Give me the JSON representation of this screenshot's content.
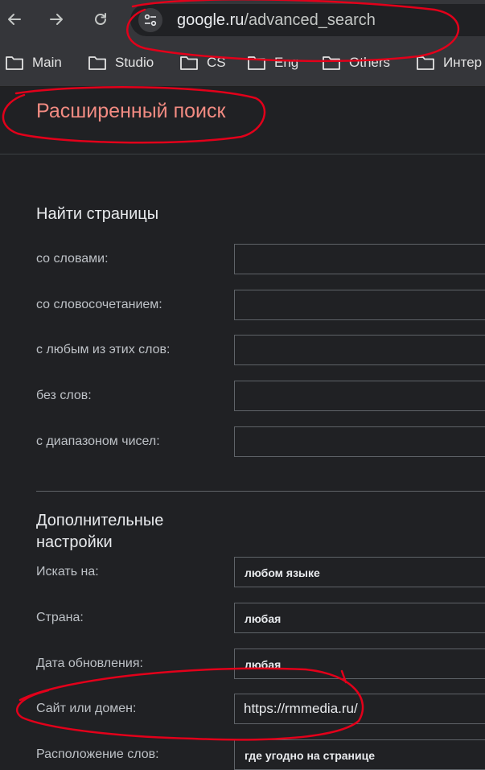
{
  "browser": {
    "url_host": "google.ru",
    "url_path": "/advanced_search",
    "bookmarks": [
      {
        "label": "Main"
      },
      {
        "label": "Studio"
      },
      {
        "label": "CS"
      },
      {
        "label": "Eng"
      },
      {
        "label": "Others"
      },
      {
        "label": "Интер"
      }
    ]
  },
  "page": {
    "title": "Расширенный поиск",
    "find_pages": {
      "heading": "Найти страницы",
      "rows": [
        {
          "label": "со словами:",
          "value": ""
        },
        {
          "label": "со словосочетанием:",
          "value": ""
        },
        {
          "label": "с любым из этих слов:",
          "value": ""
        },
        {
          "label": "без слов:",
          "value": ""
        },
        {
          "label": "с диапазоном чисел:",
          "value": ""
        }
      ]
    },
    "advanced": {
      "heading": "Дополнительные настройки",
      "language": {
        "label": "Искать на:",
        "value": "любом языке"
      },
      "region": {
        "label": "Страна:",
        "value": "любая"
      },
      "last_update": {
        "label": "Дата обновления:",
        "value": "любая"
      },
      "site": {
        "label": "Сайт или домен:",
        "value": "https://rmmedia.ru/"
      },
      "terms_appearing": {
        "label": "Расположение слов:",
        "value": "где угодно на странице"
      }
    }
  },
  "colors": {
    "background": "#202124",
    "title": "#f28b82",
    "annotation": "#e2001a"
  }
}
